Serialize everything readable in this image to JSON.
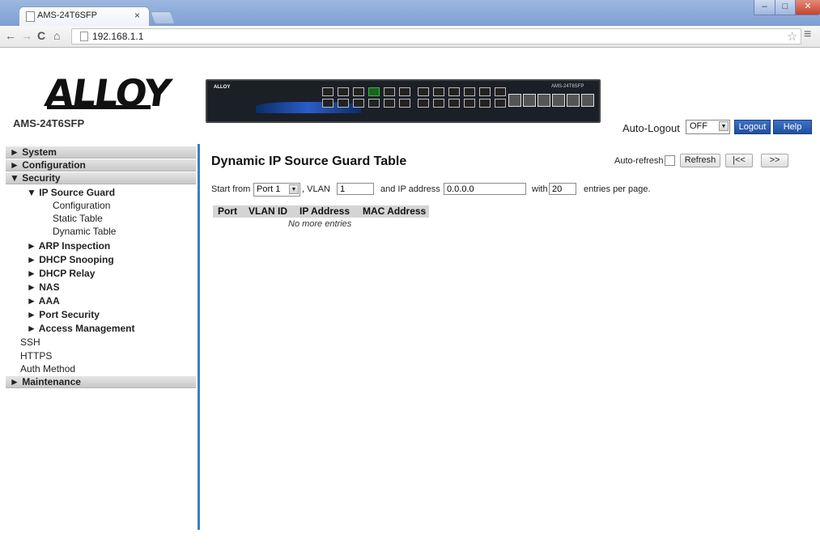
{
  "browser": {
    "tab_title": "AMS-24T6SFP",
    "tab_close": "×",
    "url": "192.168.1.1"
  },
  "header": {
    "logo_text": "ALLOY",
    "model": "AMS-24T6SFP",
    "device_image": {
      "brand": "ALLOY",
      "model": "AMS-24T6SFP"
    },
    "auto_logout_label": "Auto-Logout",
    "auto_logout_value": "OFF",
    "logout_label": "Logout",
    "help_label": "Help"
  },
  "sidebar": {
    "items": [
      {
        "label": "System",
        "type": "section",
        "arrow": "►"
      },
      {
        "label": "Configuration",
        "type": "section",
        "arrow": "►"
      },
      {
        "label": "Security",
        "type": "section",
        "arrow": "▼"
      },
      {
        "label": "IP Source Guard",
        "type": "group",
        "arrow": "▼"
      },
      {
        "label": "Configuration",
        "type": "link"
      },
      {
        "label": "Static Table",
        "type": "link"
      },
      {
        "label": "Dynamic Table",
        "type": "link"
      },
      {
        "label": "ARP Inspection",
        "type": "group",
        "arrow": "►"
      },
      {
        "label": "DHCP Snooping",
        "type": "group",
        "arrow": "►"
      },
      {
        "label": "DHCP Relay",
        "type": "group",
        "arrow": "►"
      },
      {
        "label": "NAS",
        "type": "group",
        "arrow": "►"
      },
      {
        "label": "AAA",
        "type": "group",
        "arrow": "►"
      },
      {
        "label": "Port Security",
        "type": "group",
        "arrow": "►"
      },
      {
        "label": "Access Management",
        "type": "group",
        "arrow": "►"
      },
      {
        "label": "SSH",
        "type": "link"
      },
      {
        "label": "HTTPS",
        "type": "link"
      },
      {
        "label": "Auth Method",
        "type": "link"
      },
      {
        "label": "Maintenance",
        "type": "section",
        "arrow": "►"
      }
    ]
  },
  "main": {
    "title": "Dynamic IP Source Guard Table",
    "auto_refresh_label": "Auto-refresh",
    "auto_refresh_checked": false,
    "refresh_label": "Refresh",
    "prev_label": "|<<",
    "next_label": ">>",
    "filter": {
      "start_from_label": "Start from",
      "port_value": "Port 1",
      "vlan_label": ", VLAN",
      "vlan_value": "1",
      "ip_label": "and IP address",
      "ip_value": "0.0.0.0",
      "with_label": "with",
      "entries_value": "20",
      "entries_label": "entries per page."
    },
    "table": {
      "columns": [
        "Port",
        "VLAN ID",
        "IP Address",
        "MAC Address"
      ],
      "rows": [],
      "empty_text": "No more entries"
    }
  },
  "colors": {
    "accent": "#1f4fa0",
    "sidebar_divider": "#3a7fc7",
    "menu_bar": "#d0d0d0",
    "table_header": "#d4d4d4"
  },
  "icons": [
    "page-icon",
    "close-icon",
    "back-icon",
    "forward-icon",
    "reload-icon",
    "home-icon",
    "star-icon",
    "menu-icon",
    "dropdown-arrow-icon"
  ]
}
